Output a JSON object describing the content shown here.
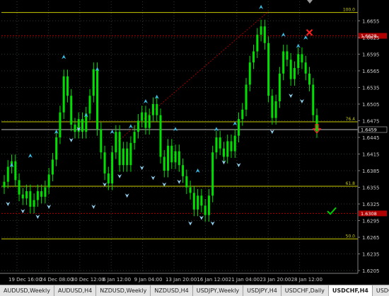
{
  "colors": {
    "background": "#000000",
    "grid": "#2b3a2b",
    "candle": "#00e000",
    "arrow_up": "#3ac0e8",
    "arrow_down": "#8fd0ee",
    "fib_line": "#c8c800",
    "sl_line": "#b00000",
    "price_label_bg": "#b00000",
    "current_price_bg": "#000000",
    "current_price_line": "#c0c0c0",
    "cross_marker": "#ff2020",
    "check_marker": "#00d000",
    "down_arrow_marker": "#ff2020"
  },
  "chart_data": {
    "type": "line",
    "symbol": "USDCHF",
    "timeframe": "H4",
    "ylim": [
      1.62,
      1.669
    ],
    "y_ticks": [
      "1.6655",
      "1.6625",
      "1.6595",
      "1.6565",
      "1.6535",
      "1.6505",
      "1.6475",
      "1.6445",
      "1.6415",
      "1.6385",
      "1.6355",
      "1.6325",
      "1.6295",
      "1.6265",
      "1.6235",
      "1.6205"
    ],
    "x_ticks": [
      "19 Dec 16:00",
      "24 Dec 08:00",
      "30 Dec 12:00",
      "6 Jan 12:00",
      "9 Jan 04:00",
      "13 Jan 20:00",
      "16 Jan 12:00",
      "21 Jan 04:00",
      "23 Jan 20:00",
      "28 Jan 12:00"
    ],
    "levels": [
      {
        "label": "100.0",
        "value": 1.667,
        "kind": "fib"
      },
      {
        "label": "76.4",
        "value": 1.6473,
        "kind": "fib"
      },
      {
        "label": "61.8",
        "value": 1.6357,
        "kind": "fib"
      },
      {
        "label": "50.0",
        "value": 1.6262,
        "kind": "fib"
      },
      {
        "label": "1.6628",
        "value": 1.6628,
        "kind": "sl"
      },
      {
        "label": "1.6308",
        "value": 1.6308,
        "kind": "sl"
      }
    ],
    "current_price": "1.6459",
    "close": [
      1.6365,
      1.6392,
      1.6402,
      1.6368,
      1.6342,
      1.6335,
      1.6348,
      1.632,
      1.6332,
      1.6348,
      1.6338,
      1.6355,
      1.6378,
      1.6405,
      1.6445,
      1.649,
      1.6555,
      1.652,
      1.6468,
      1.6455,
      1.6478,
      1.6455,
      1.6488,
      1.652,
      1.6568,
      1.646,
      1.6418,
      1.638,
      1.6362,
      1.6418,
      1.6455,
      1.6395,
      1.6425,
      1.6395,
      1.6435,
      1.6455,
      1.6475,
      1.649,
      1.6462,
      1.6485,
      1.6505,
      1.6485,
      1.641,
      1.6385,
      1.643,
      1.64,
      1.642,
      1.6395,
      1.6375,
      1.6355,
      1.6345,
      1.6315,
      1.634,
      1.6322,
      1.6305,
      1.634,
      1.6418,
      1.6445,
      1.6425,
      1.641,
      1.6438,
      1.642,
      1.6448,
      1.6478,
      1.6495,
      1.654,
      1.658,
      1.66,
      1.663,
      1.6645,
      1.6615,
      1.652,
      1.648,
      1.651,
      1.656,
      1.66,
      1.6585,
      1.655,
      1.657,
      1.6595,
      1.658,
      1.656,
      1.654,
      1.6485,
      1.6456
    ],
    "arrows_up": [
      [
        2,
        1.6395
      ],
      [
        7,
        1.6412
      ],
      [
        14,
        1.6455
      ],
      [
        16,
        1.659
      ],
      [
        22,
        1.6485
      ],
      [
        25,
        1.6568
      ],
      [
        29,
        1.6455
      ],
      [
        34,
        1.6465
      ],
      [
        38,
        1.651
      ],
      [
        41,
        1.6518
      ],
      [
        46,
        1.646
      ],
      [
        52,
        1.6385
      ],
      [
        57,
        1.646
      ],
      [
        62,
        1.647
      ],
      [
        69,
        1.668
      ],
      [
        75,
        1.663
      ],
      [
        79,
        1.661
      ],
      [
        81,
        1.6625
      ]
    ],
    "arrows_down": [
      [
        1,
        1.6325
      ],
      [
        5,
        1.6312
      ],
      [
        9,
        1.6302
      ],
      [
        12,
        1.632
      ],
      [
        18,
        1.644
      ],
      [
        20,
        1.646
      ],
      [
        24,
        1.632
      ],
      [
        27,
        1.636
      ],
      [
        31,
        1.6375
      ],
      [
        33,
        1.634
      ],
      [
        37,
        1.639
      ],
      [
        40,
        1.6372
      ],
      [
        43,
        1.636
      ],
      [
        47,
        1.6365
      ],
      [
        50,
        1.629
      ],
      [
        53,
        1.63
      ],
      [
        56,
        1.629
      ],
      [
        59,
        1.64
      ],
      [
        63,
        1.6395
      ],
      [
        72,
        1.6455
      ],
      [
        77,
        1.652
      ],
      [
        80,
        1.651
      ]
    ],
    "markers": [
      {
        "type": "cross",
        "x": 82,
        "y": 1.6634
      },
      {
        "type": "down_arrow",
        "x": 84,
        "y": 1.6458
      },
      {
        "type": "check",
        "x": 88,
        "y": 1.6312
      }
    ],
    "trend_line": [
      [
        30,
        1.6435
      ],
      [
        71,
        1.6672
      ]
    ]
  },
  "tabs": [
    {
      "label": "AUDUSD,Weekly",
      "active": false
    },
    {
      "label": "AUDUSD,H4",
      "active": false
    },
    {
      "label": "NZDUSD,Weekly",
      "active": false
    },
    {
      "label": "NZDUSD,H4",
      "active": false
    },
    {
      "label": "USDJPY,Weekly",
      "active": false
    },
    {
      "label": "USDJPY,H4",
      "active": false
    },
    {
      "label": "USDCHF,Daily",
      "active": false
    },
    {
      "label": "USDCHF,H4",
      "active": true
    },
    {
      "label": "USDCAD,We",
      "active": false
    }
  ]
}
